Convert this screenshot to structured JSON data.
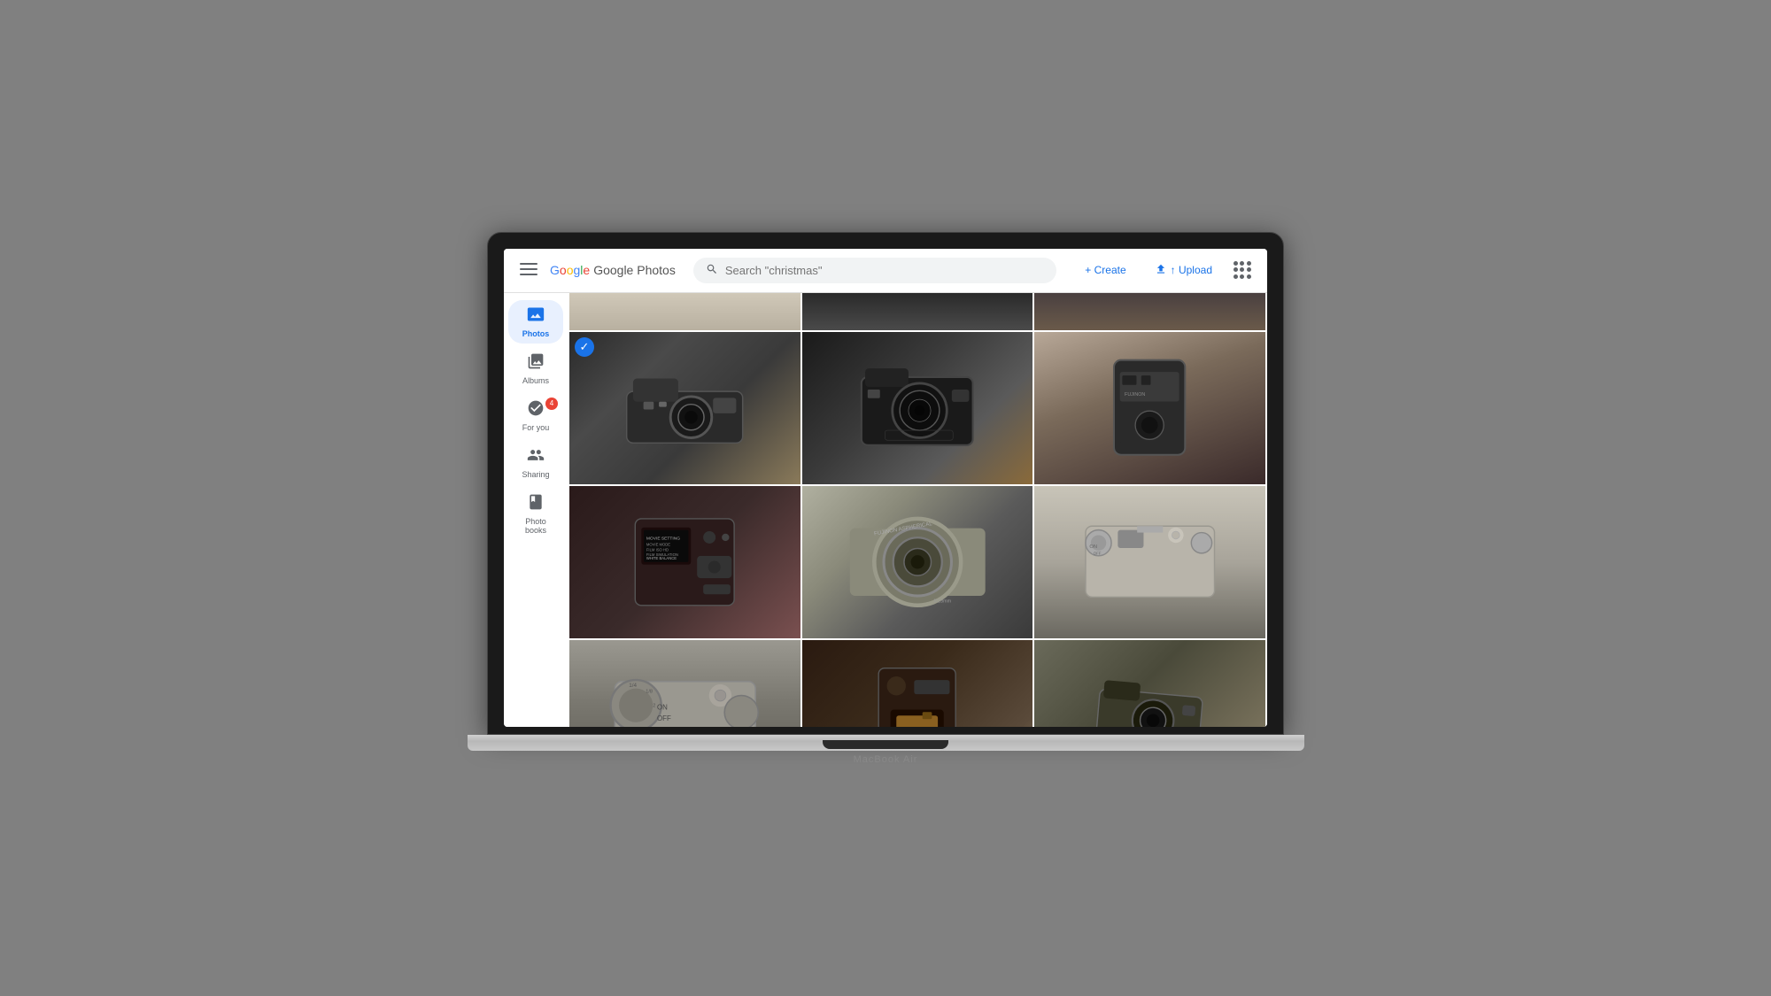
{
  "macbook": {
    "label": "MacBook Air"
  },
  "header": {
    "menu_icon": "☰",
    "logo_text": "Google Photos",
    "search_placeholder": "Search \"christmas\"",
    "create_label": "+ Create",
    "upload_label": "↑ Upload"
  },
  "sidebar": {
    "items": [
      {
        "id": "photos",
        "label": "Photos",
        "icon": "🖼",
        "active": true,
        "badge": null
      },
      {
        "id": "albums",
        "label": "Albums",
        "icon": "📚",
        "active": false,
        "badge": null
      },
      {
        "id": "for-you",
        "label": "For you",
        "icon": "✨",
        "active": false,
        "badge": "4"
      },
      {
        "id": "sharing",
        "label": "Sharing",
        "icon": "👤",
        "active": false,
        "badge": null
      },
      {
        "id": "photo-books",
        "label": "Photo books",
        "icon": "📖",
        "active": false,
        "badge": null
      }
    ]
  },
  "grid": {
    "photos": [
      {
        "id": "photo-1",
        "alt": "Fujifilm X100 camera angled view"
      },
      {
        "id": "photo-2",
        "alt": "Fujifilm camera front lens view"
      },
      {
        "id": "photo-3",
        "alt": "Camera side view close-up"
      },
      {
        "id": "photo-4",
        "alt": "Camera back menu screen"
      },
      {
        "id": "photo-5",
        "alt": "Camera lens close-up silver"
      },
      {
        "id": "photo-6",
        "alt": "Camera top view controls"
      },
      {
        "id": "photo-7",
        "alt": "Camera top dial close-up"
      },
      {
        "id": "photo-8",
        "alt": "Camera battery compartment open"
      },
      {
        "id": "photo-9",
        "alt": "Camera on wooden surface tilted"
      }
    ]
  }
}
